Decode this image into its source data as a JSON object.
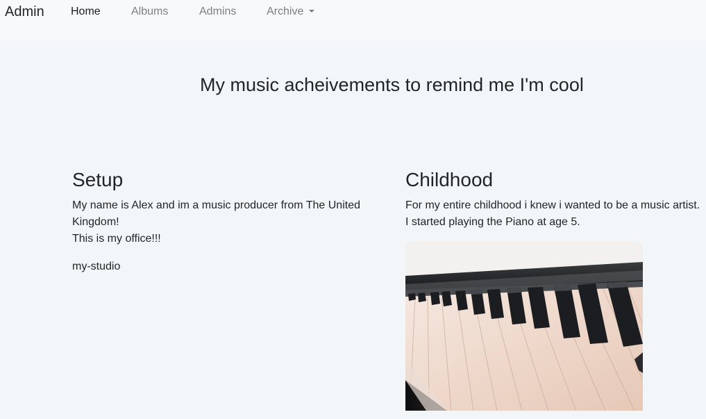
{
  "navbar": {
    "brand": "Admin",
    "links": [
      {
        "label": "Home",
        "active": true
      },
      {
        "label": "Albums",
        "active": false
      },
      {
        "label": "Admins",
        "active": false
      },
      {
        "label": "Archive",
        "active": false,
        "dropdown": true
      }
    ]
  },
  "hero": {
    "title": "My music acheivements to remind me I'm cool"
  },
  "sections": [
    {
      "heading": "Setup",
      "lines": [
        "My name is Alex and im a music producer from The United Kingdom!",
        "This is my office!!!"
      ],
      "caption": "my-studio"
    },
    {
      "heading": "Childhood",
      "lines": [
        "For my entire childhood i knew i wanted to be a music artist.",
        "I started playing the Piano at age 5."
      ],
      "image": "piano-keyboard-photo"
    }
  ]
}
